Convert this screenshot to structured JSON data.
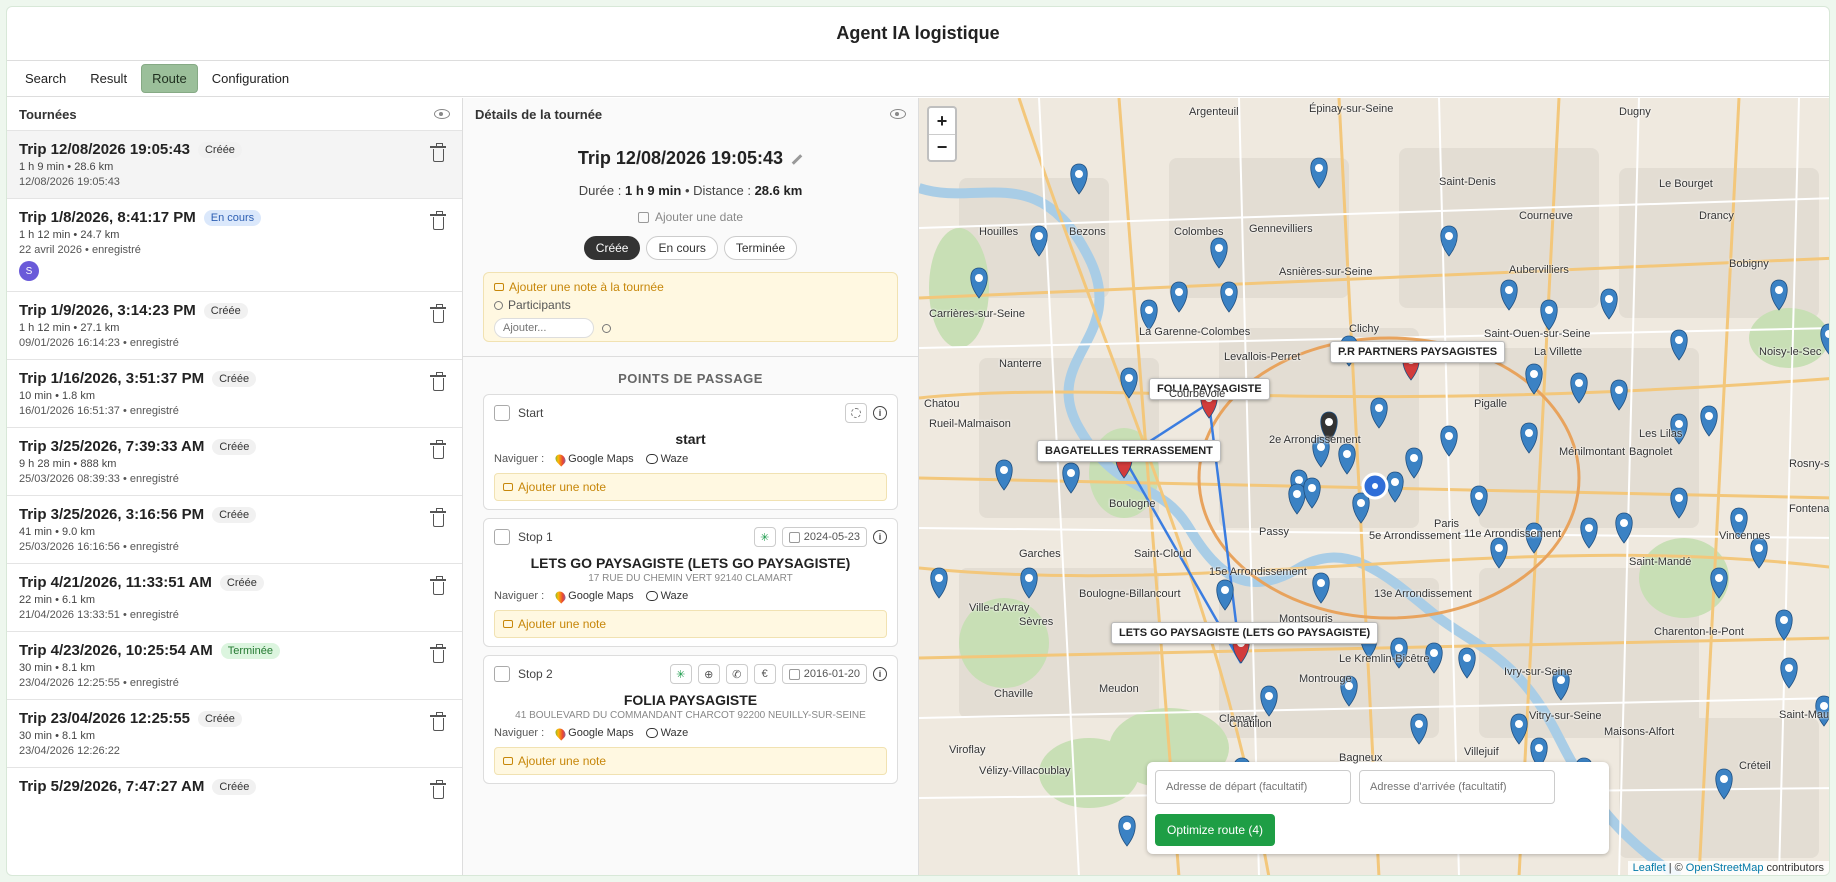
{
  "app": {
    "title": "Agent IA logistique"
  },
  "tabs": [
    {
      "label": "Search"
    },
    {
      "label": "Result"
    },
    {
      "label": "Route"
    },
    {
      "label": "Configuration"
    }
  ],
  "tournees": {
    "title": "Tournées",
    "trips": [
      {
        "title": "Trip 12/08/2026 19:05:43",
        "status": "Créée",
        "meta": "1 h 9 min • 28.6 km",
        "date": "12/08/2026 19:05:43"
      },
      {
        "title": "Trip 1/8/2026, 8:41:17 PM",
        "status": "En cours",
        "meta": "1 h 12 min • 24.7 km",
        "date": "22 avril 2026 • enregistré",
        "avatar": "S"
      },
      {
        "title": "Trip 1/9/2026, 3:14:23 PM",
        "status": "Créée",
        "meta": "1 h 12 min • 27.1 km",
        "date": "09/01/2026 16:14:23 • enregistré"
      },
      {
        "title": "Trip 1/16/2026, 3:51:37 PM",
        "status": "Créée",
        "meta": "10 min • 1.8 km",
        "date": "16/01/2026 16:51:37 • enregistré"
      },
      {
        "title": "Trip 3/25/2026, 7:39:33 AM",
        "status": "Créée",
        "meta": "9 h 28 min • 888 km",
        "date": "25/03/2026 08:39:33 • enregistré"
      },
      {
        "title": "Trip 3/25/2026, 3:16:56 PM",
        "status": "Créée",
        "meta": "41 min • 9.0 km",
        "date": "25/03/2026 16:16:56 • enregistré"
      },
      {
        "title": "Trip 4/21/2026, 11:33:51 AM",
        "status": "Créée",
        "meta": "22 min • 6.1 km",
        "date": "21/04/2026 13:33:51 • enregistré"
      },
      {
        "title": "Trip 4/23/2026, 10:25:54 AM",
        "status": "Terminée",
        "meta": "30 min • 8.1 km",
        "date": "23/04/2026 12:25:55 • enregistré"
      },
      {
        "title": "Trip 23/04/2026 12:25:55",
        "status": "Créée",
        "meta": "30 min • 8.1 km",
        "date": "23/04/2026 12:26:22"
      },
      {
        "title": "Trip 5/29/2026, 7:47:27 AM",
        "status": "Créée",
        "meta": "",
        "date": ""
      }
    ]
  },
  "details": {
    "title": "Détails de la tournée",
    "trip_title": "Trip 12/08/2026 19:05:43",
    "duration_label": "Durée :",
    "duration": "1 h 9 min",
    "distance_label": "• Distance :",
    "distance": "28.6 km",
    "add_date": "Ajouter une date",
    "statuses": [
      "Créée",
      "En cours",
      "Terminée"
    ],
    "add_note": "Ajouter une note à la tournée",
    "participants": "Participants",
    "add_placeholder": "Ajouter...",
    "section": "POINTS DE PASSAGE",
    "nav_label": "Naviguer :",
    "google_maps": "Google Maps",
    "waze": "Waze",
    "note_label": "Ajouter une note",
    "stops": [
      {
        "label": "Start",
        "name": "start",
        "address": ""
      },
      {
        "label": "Stop 1",
        "name": "LETS GO PAYSAGISTE (LETS GO PAYSAGISTE)",
        "address": "17 RUE DU CHEMIN VERT 92140 CLAMART",
        "date": "2024-05-23"
      },
      {
        "label": "Stop 2",
        "name": "FOLIA PAYSAGISTE",
        "address": "41 BOULEVARD DU COMMANDANT CHARCOT 92200 NEUILLY-SUR-SEINE",
        "date": "2016-01-20"
      }
    ]
  },
  "map": {
    "labels": {
      "partners": "P.R PARTNERS PAYSAGISTES",
      "folia": "FOLIA PAYSAGISTE",
      "bagatelles": "BAGATELLES TERRASSEMENT",
      "letsgo": "LETS GO PAYSAGISTE (LETS GO PAYSAGISTE)"
    },
    "places": [
      "Argenteuil",
      "Épinay-sur-Seine",
      "Dugny",
      "Saint-Denis",
      "Le Bourget",
      "Houilles",
      "Bezons",
      "Colombes",
      "Gennevilliers",
      "Courneuve",
      "Drancy",
      "Aubervilliers",
      "Asnières-sur-Seine",
      "Carrières-sur-Seine",
      "La Garenne-Colombes",
      "Saint-Ouen-sur-Seine",
      "Bobigny",
      "Clichy",
      "Nanterre",
      "Courbevoie",
      "Levallois-Perret",
      "La Villette",
      "Noisy-le-Sec",
      "Chatou",
      "Rueil-Malmaison",
      "Pigalle",
      "Les Lilas",
      "2e Arrondissement",
      "Ménilmontant",
      "Bagnolet",
      "Paris",
      "Passy",
      "Boulogne",
      "Saint-Cloud",
      "Garches",
      "15e Arrondissement",
      "5e Arrondissement",
      "11e Arrondissement",
      "Saint-Mandé",
      "Vincennes",
      "Fontenay-sous-Bois",
      "Rosny-sous-Bois",
      "Boulogne-Billancourt",
      "13e Arrondissement",
      "Ville-d'Avray",
      "Sèvres",
      "Montsouris",
      "Charenton-le-Pont",
      "Meudon",
      "Chaville",
      "Montrouge",
      "Le Kremlin-Bicêtre",
      "Ivry-sur-Seine",
      "Clamart",
      "Châtillon",
      "Vitry-sur-Seine",
      "Maisons-Alfort",
      "Saint-Maur-des-Fossés",
      "Viroflay",
      "Vélizy-Villacoublay",
      "Bagneux",
      "Villejuif",
      "Créteil"
    ],
    "zoom_in": "+",
    "zoom_out": "−",
    "start_placeholder": "Adresse de départ (facultatif)",
    "end_placeholder": "Adresse d'arrivée (facultatif)",
    "optimize_label": "Optimize route (4)",
    "attribution": {
      "leaflet": "Leaflet",
      "sep": "| ©",
      "osm": "OpenStreetMap",
      "contrib": "contributors"
    }
  },
  "colors": {
    "accent_tab": "#9bbf9a",
    "pin_blue": "#3b82c4",
    "pin_red": "#d23c3c",
    "route_blue": "#3b7de0",
    "optimize_green": "#1e9e45"
  }
}
